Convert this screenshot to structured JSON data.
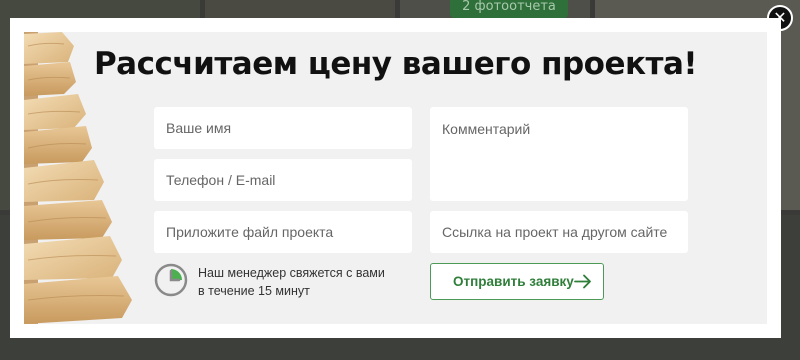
{
  "background": {
    "badge_text": "2 фотоотчета"
  },
  "modal": {
    "title": "Рассчитаем цену вашего проекта!",
    "fields": {
      "name_placeholder": "Ваше имя",
      "contact_placeholder": "Телефон / E-mail",
      "file_placeholder": "Приложите файл проекта",
      "comment_placeholder": "Комментарий",
      "link_placeholder": "Ссылка на проект на другом сайте"
    },
    "manager_note": {
      "line1": "Наш менеджер свяжется с вами",
      "line2": "в течение 15 минут"
    },
    "submit_label": "Отправить заявку",
    "close_symbol": "✕"
  },
  "icons": [
    "close-icon",
    "clock-icon",
    "arrow-right-icon"
  ],
  "colors": {
    "accent_green": "#2f7e3a",
    "modal_bg": "#f1f1f1",
    "field_bg": "#ffffff"
  }
}
